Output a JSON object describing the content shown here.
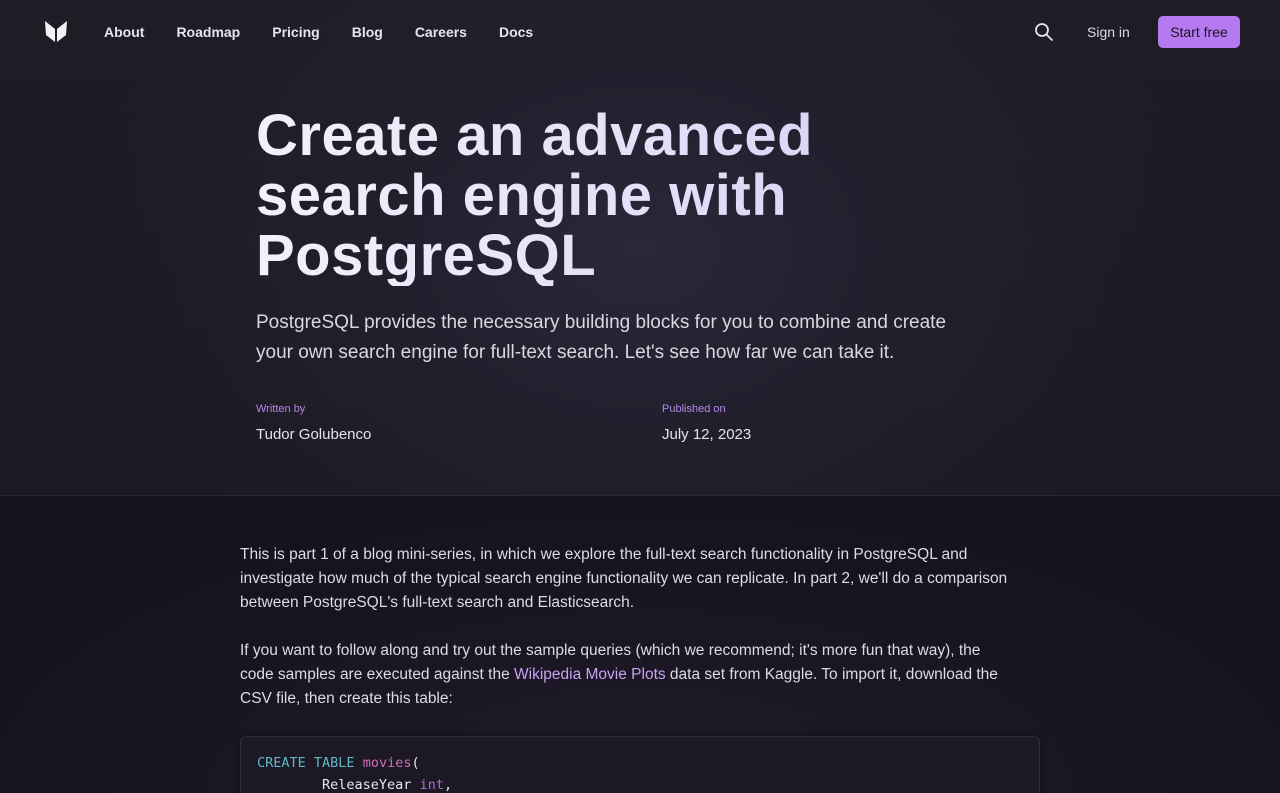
{
  "nav": {
    "logo": "butterfly-logo",
    "links": [
      "About",
      "Roadmap",
      "Pricing",
      "Blog",
      "Careers",
      "Docs"
    ],
    "search_icon": "search-icon",
    "sign_in": "Sign in",
    "start_free": "Start free",
    "accent": "#b57aef"
  },
  "hero": {
    "title_line1": "Create an advanced",
    "title_line2": "search engine with",
    "title_line3": "PostgreSQL",
    "subtitle_line1": "PostgreSQL provides the necessary building blocks for you to combine and create",
    "subtitle_line2": "your own search engine for full-text search. Let's see how far we can take it.",
    "written_by_label": "Written by",
    "author": "Tudor Golubenco",
    "published_label": "Published on",
    "date": "July 12, 2023"
  },
  "article": {
    "para1_line1": "This is part 1 of a blog mini-series, in which we explore the full-text search functionality in PostgreSQL and",
    "para1_line2": "investigate how much of the typical search engine functionality we can replicate. In part 2, we'll do a comparison",
    "para1_line3": "between PostgreSQL's full-text search and Elasticsearch.",
    "para2_line1": "If you want to follow along and try out the sample queries (which we recommend; it's more fun that way), the",
    "para2_line2_before": "code samples are executed against the ",
    "para2_link": "Wikipedia Movie Plots",
    "para2_line2_after": " data set from Kaggle. To import it, download the",
    "para2_line3": "CSV file, then create this table:"
  },
  "code": {
    "line1_kw1": "CREATE",
    "line1_kw2": "TABLE",
    "line1_ident": "movies",
    "line1_paren": "(",
    "line2_indent": "        ",
    "line2_col": "ReleaseYear",
    "line2_type": "int",
    "line2_comma": ","
  }
}
